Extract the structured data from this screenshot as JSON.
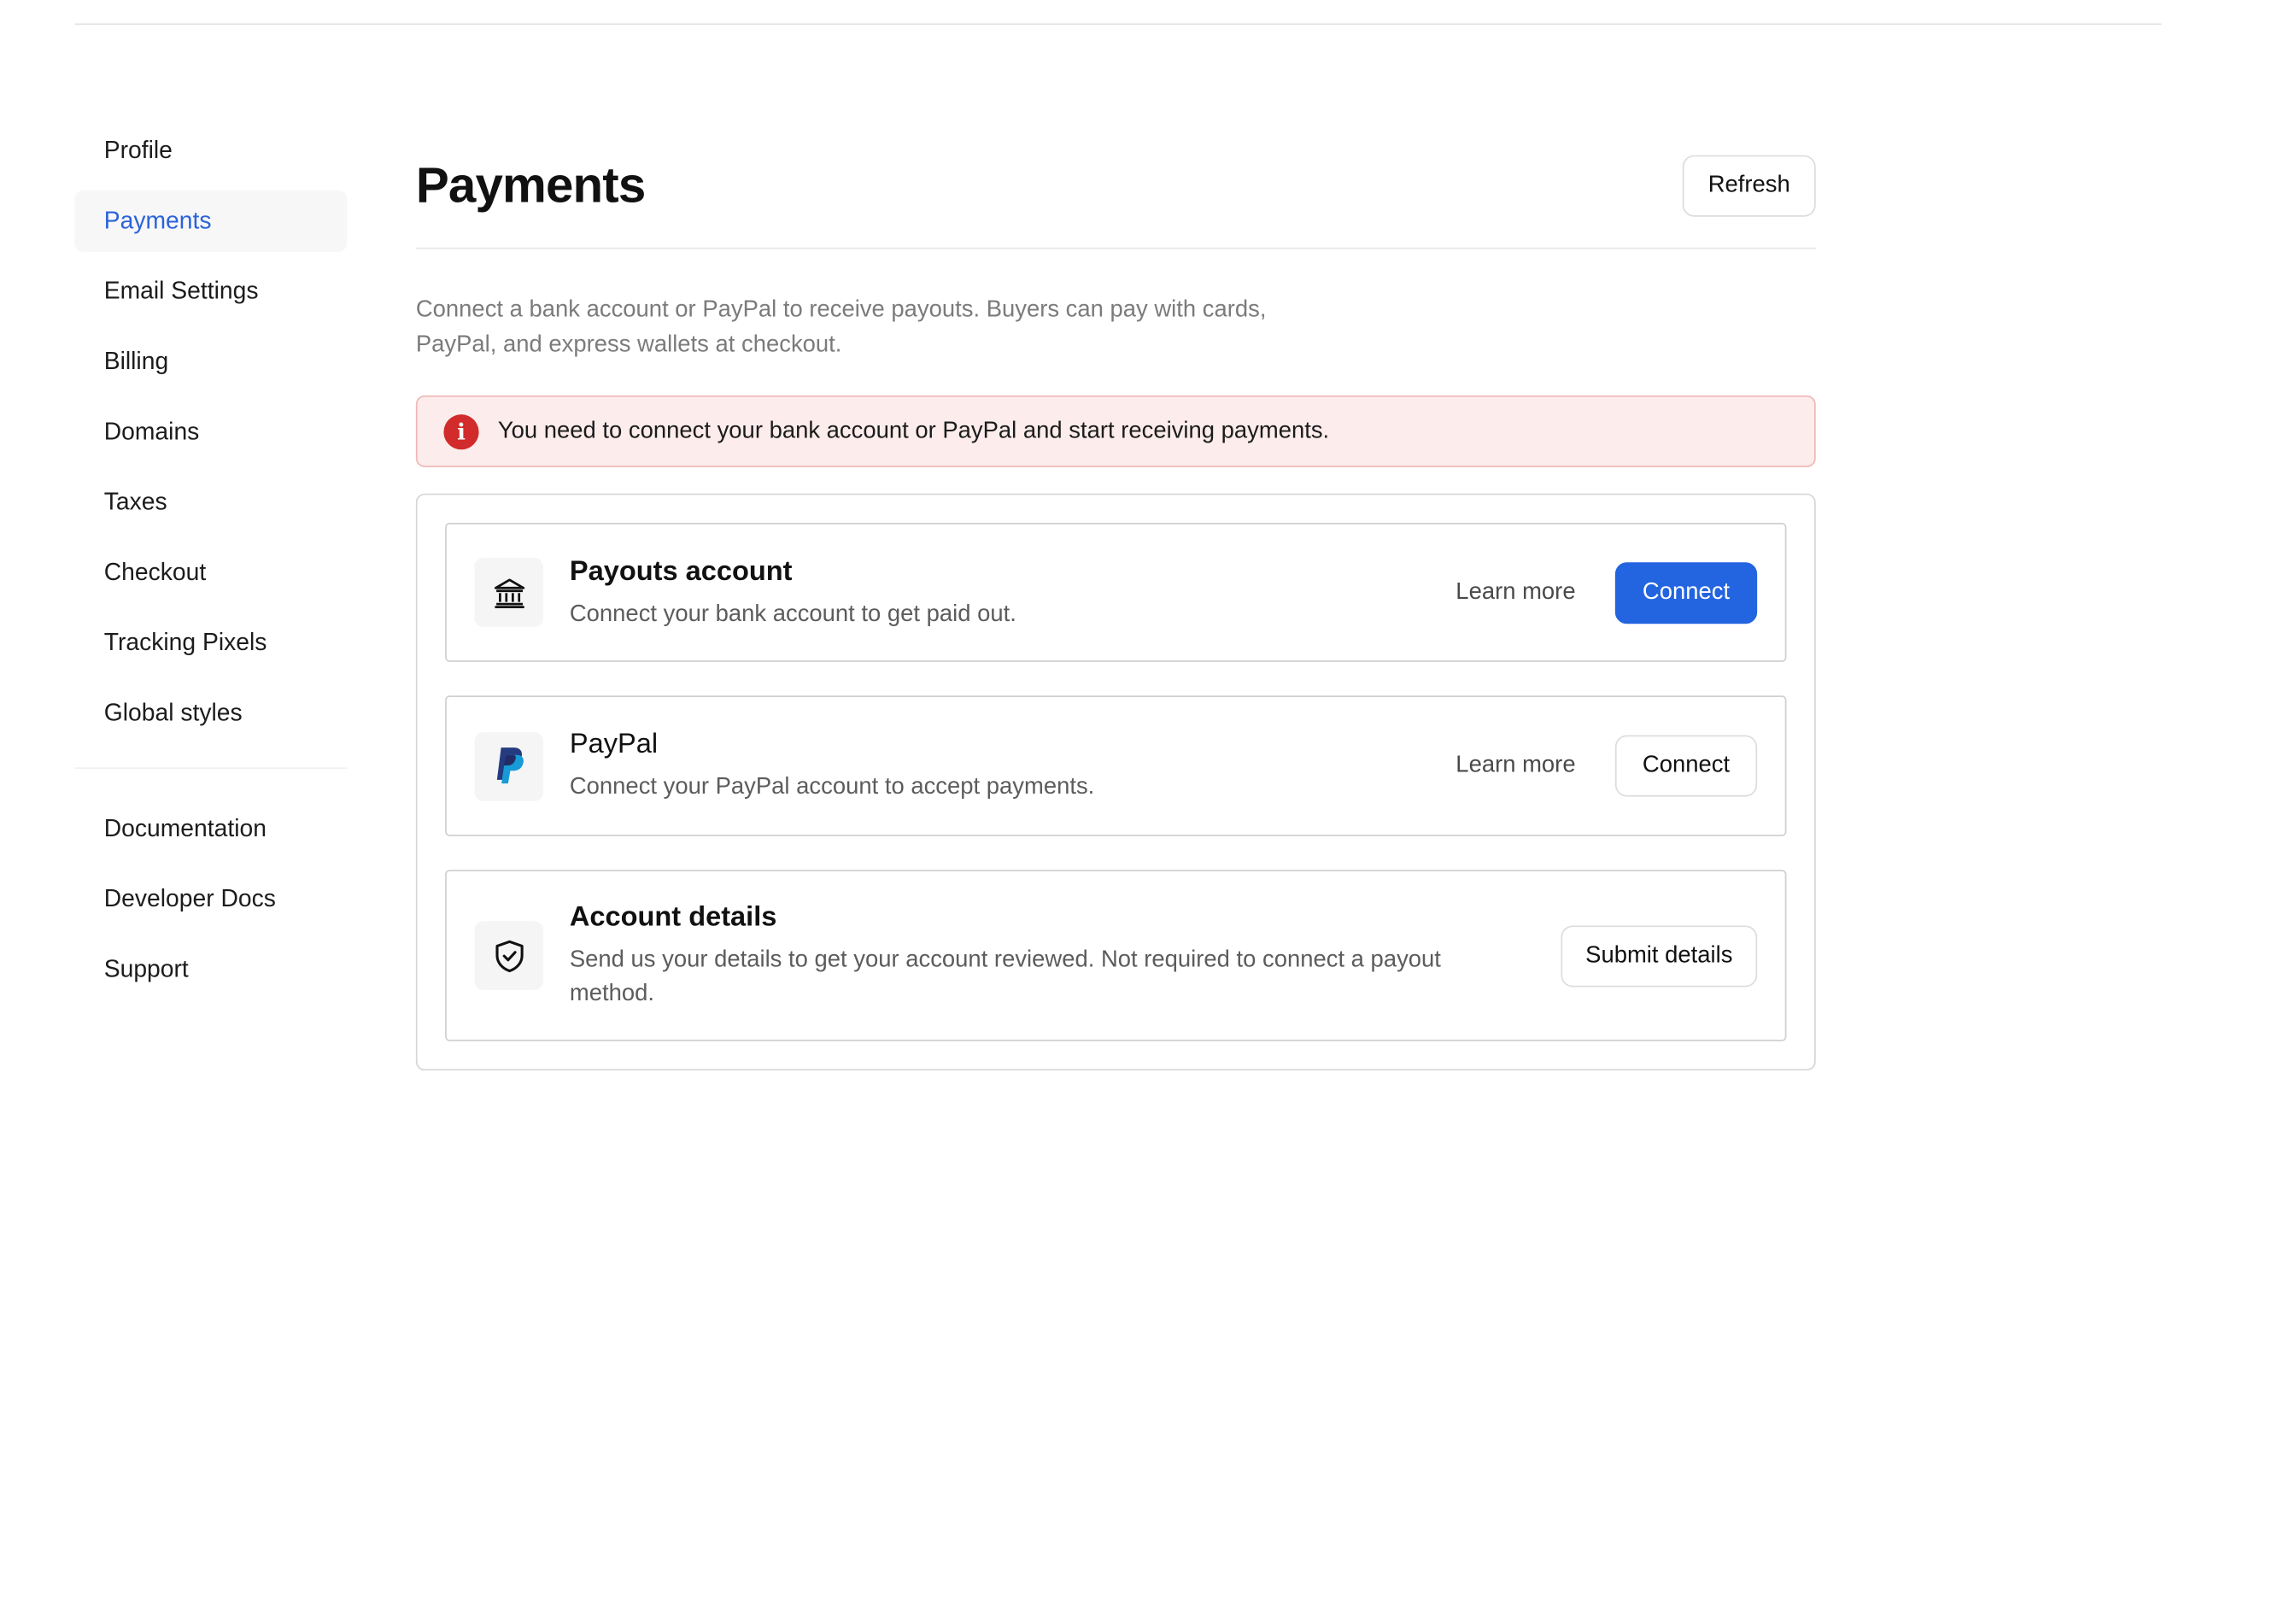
{
  "sidebar": {
    "items": [
      {
        "label": "Profile",
        "active": false
      },
      {
        "label": "Payments",
        "active": true
      },
      {
        "label": "Email Settings",
        "active": false
      },
      {
        "label": "Billing",
        "active": false
      },
      {
        "label": "Domains",
        "active": false
      },
      {
        "label": "Taxes",
        "active": false
      },
      {
        "label": "Checkout",
        "active": false
      },
      {
        "label": "Tracking Pixels",
        "active": false
      },
      {
        "label": "Global styles",
        "active": false
      }
    ],
    "secondary_items": [
      {
        "label": "Documentation"
      },
      {
        "label": "Developer Docs"
      },
      {
        "label": "Support"
      }
    ]
  },
  "header": {
    "title": "Payments",
    "refresh_label": "Refresh"
  },
  "intro": "Connect a bank account or PayPal to receive payouts. Buyers can pay with cards, PayPal, and express wallets at checkout.",
  "alert": {
    "text": "You need to connect your bank account or PayPal and start receiving payments.",
    "icon": "info-icon",
    "color": "#d12b2b"
  },
  "cards": {
    "payouts": {
      "icon": "bank-icon",
      "title": "Payouts account",
      "description": "Connect your bank account to get paid out.",
      "learn_more": "Learn more",
      "connect": "Connect"
    },
    "paypal": {
      "icon": "paypal-icon",
      "title": "PayPal",
      "description": "Connect your PayPal account to accept payments.",
      "learn_more": "Learn more",
      "connect": "Connect"
    },
    "account_details": {
      "icon": "shield-check-icon",
      "title": "Account details",
      "description": "Send us your details to get your account reviewed. Not required to connect a payout method.",
      "submit": "Submit details"
    }
  },
  "colors": {
    "accent": "#2364e0",
    "active_nav": "#2b63d9",
    "alert_bg": "#fcecec"
  }
}
